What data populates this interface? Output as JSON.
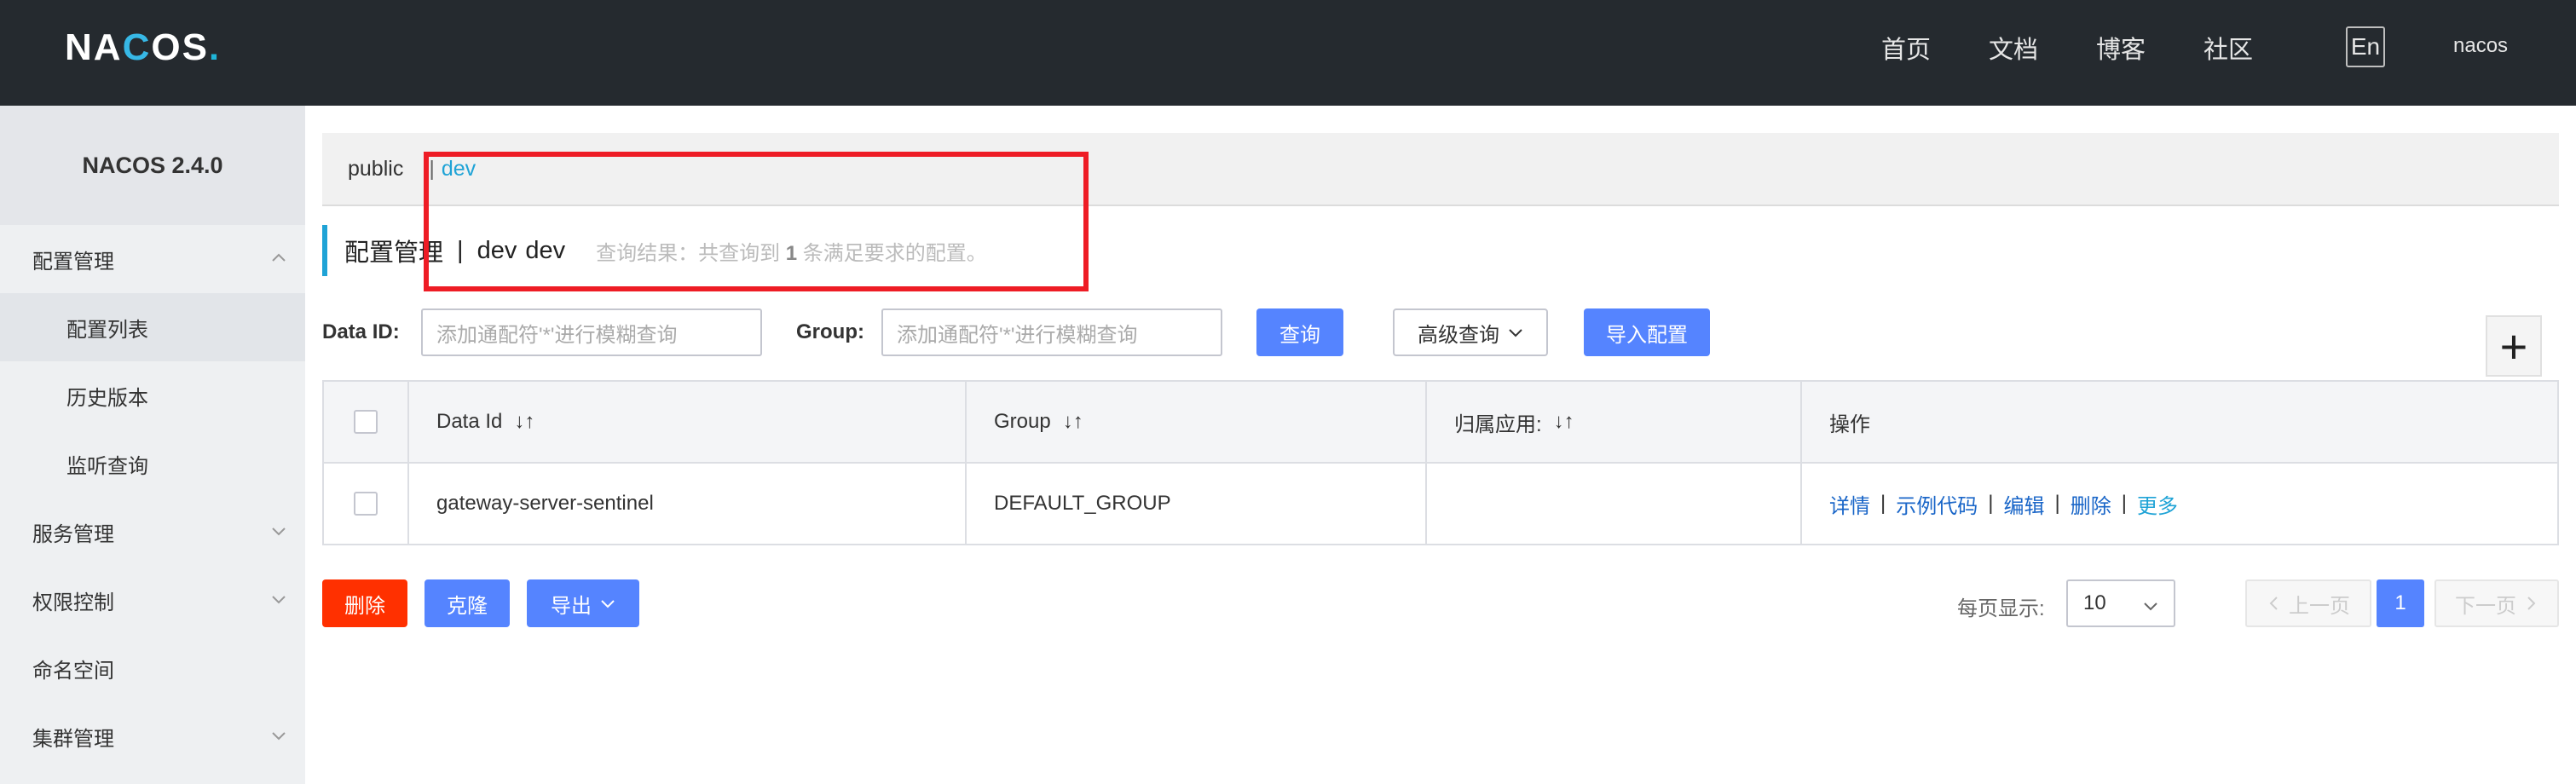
{
  "header": {
    "logo": {
      "part1": "NA",
      "part2": "C",
      "part3": "OS",
      "dot": "."
    },
    "nav": [
      "首页",
      "文档",
      "博客",
      "社区"
    ],
    "lang": "En",
    "user": "nacos"
  },
  "sidebar": {
    "title": "NACOS 2.4.0",
    "items": [
      {
        "label": "配置管理",
        "level": 1,
        "expanded": true
      },
      {
        "label": "配置列表",
        "level": 2,
        "active": true
      },
      {
        "label": "历史版本",
        "level": 2
      },
      {
        "label": "监听查询",
        "level": 2
      },
      {
        "label": "服务管理",
        "level": 1,
        "expanded": false
      },
      {
        "label": "权限控制",
        "level": 1,
        "expanded": false
      },
      {
        "label": "命名空间",
        "level": 1
      },
      {
        "label": "集群管理",
        "level": 1,
        "expanded": false
      }
    ]
  },
  "namespace_bar": {
    "public": "public",
    "separator": "|",
    "current": "dev"
  },
  "title": {
    "text": "配置管理",
    "separator": "|",
    "ns_name": "dev",
    "ns_id": "dev",
    "hint_prefix": "查询结果：共查询到",
    "hint_count": "1",
    "hint_suffix": "条满足要求的配置。"
  },
  "search": {
    "data_id_label": "Data ID:",
    "data_id_placeholder": "添加通配符'*'进行模糊查询",
    "group_label": "Group:",
    "group_placeholder": "添加通配符'*'进行模糊查询",
    "query_button": "查询",
    "advanced_button": "高级查询",
    "import_button": "导入配置",
    "add_button": "+"
  },
  "table": {
    "headers": [
      "Data Id",
      "Group",
      "归属应用:",
      "操作"
    ],
    "sort_glyph": "↓↑",
    "rows": [
      {
        "data_id": "gateway-server-sentinel",
        "group": "DEFAULT_GROUP",
        "app": "",
        "ops": [
          "详情",
          "示例代码",
          "编辑",
          "删除",
          "更多"
        ]
      }
    ]
  },
  "footer": {
    "delete_button": "删除",
    "clone_button": "克隆",
    "export_button": "导出",
    "page_size_label": "每页显示:",
    "page_size": "10",
    "prev": "上一页",
    "current_page": "1",
    "next": "下一页"
  },
  "colors": {
    "topbar": "#252a2f",
    "primary": "#5584ff",
    "danger": "#ff3000",
    "accent": "#1fa3d6",
    "highlight_box": "#ee1c25"
  }
}
